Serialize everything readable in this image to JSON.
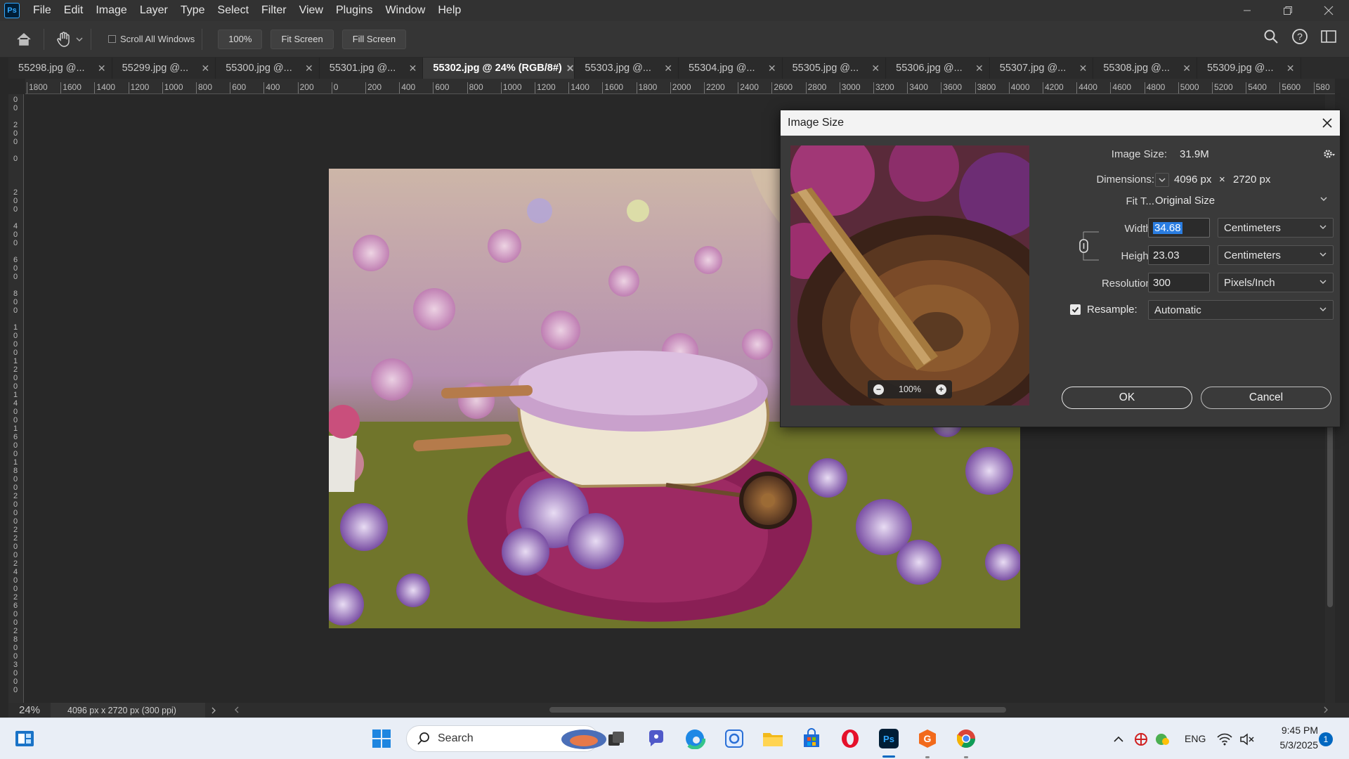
{
  "menubar": {
    "logo": "Ps",
    "items": [
      "File",
      "Edit",
      "Image",
      "Layer",
      "Type",
      "Select",
      "Filter",
      "View",
      "Plugins",
      "Window",
      "Help"
    ]
  },
  "optionsbar": {
    "scroll_all_windows": "Scroll All Windows",
    "zoom_btn": "100%",
    "fit_screen": "Fit Screen",
    "fill_screen": "Fill Screen"
  },
  "tabs": [
    {
      "label": "55298.jpg @..."
    },
    {
      "label": "55299.jpg @..."
    },
    {
      "label": "55300.jpg @..."
    },
    {
      "label": "55301.jpg @..."
    },
    {
      "label": "55302.jpg @ 24% (RGB/8#)",
      "active": true
    },
    {
      "label": "55303.jpg @..."
    },
    {
      "label": "55304.jpg @..."
    },
    {
      "label": "55305.jpg @..."
    },
    {
      "label": "55306.jpg @..."
    },
    {
      "label": "55307.jpg @..."
    },
    {
      "label": "55308.jpg @..."
    },
    {
      "label": "55309.jpg @..."
    }
  ],
  "ruler_h": [
    "1800",
    "1600",
    "1400",
    "1200",
    "1000",
    "800",
    "600",
    "400",
    "200",
    "0",
    "200",
    "400",
    "600",
    "800",
    "1000",
    "1200",
    "1400",
    "1600",
    "1800",
    "2000",
    "2200",
    "2400",
    "2600",
    "2800",
    "3000",
    "3200",
    "3400",
    "3600",
    "3800",
    "4000",
    "4200",
    "4400",
    "4600",
    "4800",
    "5000",
    "5200",
    "5400",
    "5600",
    "580"
  ],
  "ruler_v": [
    "400",
    "200",
    "0",
    "200",
    "400",
    "600",
    "800",
    "1000",
    "1200",
    "1400",
    "1600",
    "1800",
    "2000",
    "2200",
    "2400",
    "2600",
    "2800",
    "3000"
  ],
  "statusbar": {
    "zoom": "24%",
    "docinfo": "4096 px x 2720 px (300 ppi)"
  },
  "dialog": {
    "title": "Image Size",
    "image_size_label": "Image Size:",
    "image_size_value": "31.9M",
    "dimensions_label": "Dimensions:",
    "dim_width": "4096 px",
    "dim_times": "×",
    "dim_height": "2720 px",
    "fit_label": "Fit T...",
    "fit_value": "Original Size",
    "width_label": "Width:",
    "width_value": "34.68",
    "width_unit": "Centimeters",
    "height_label": "Height:",
    "height_value": "23.03",
    "height_unit": "Centimeters",
    "resolution_label": "Resolution:",
    "resolution_value": "300",
    "resolution_unit": "Pixels/Inch",
    "resample_label": "Resample:",
    "resample_value": "Automatic",
    "preview_zoom": "100%",
    "ok": "OK",
    "cancel": "Cancel"
  },
  "taskbar": {
    "search": "Search",
    "lang": "ENG",
    "time": "9:45 PM",
    "date": "5/3/2025",
    "notif_count": "1"
  }
}
